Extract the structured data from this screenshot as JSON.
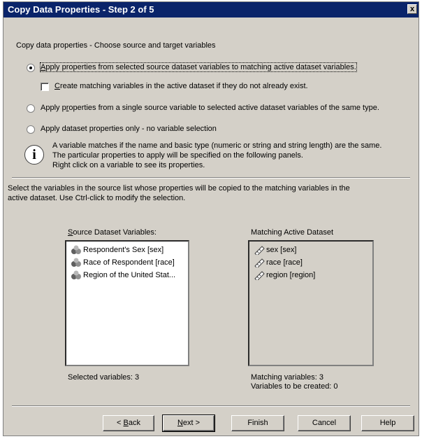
{
  "window": {
    "title": "Copy Data Properties - Step 2 of 5",
    "close_glyph": "x"
  },
  "heading": "Copy data properties - Choose source and target variables",
  "options": {
    "opt1": {
      "pre": "",
      "key": "A",
      "post": "pply properties from selected source dataset variables to matching active dataset variables.",
      "selected": true
    },
    "create_match": {
      "pre": "",
      "key": "C",
      "post": "reate matching variables in the active dataset if they do not already  exist.",
      "checked": false
    },
    "opt2": {
      "pre": "Apply p",
      "key": "r",
      "post": "operties from a single source variable to selected active dataset variables of the same type.",
      "selected": false
    },
    "opt3": {
      "label": "Apply dataset properties only -  no variable selection",
      "selected": false
    }
  },
  "info": {
    "icon_glyph": "i",
    "line1": "A variable matches if the name and basic type (numeric or string and string length) are the same.",
    "line2": "The particular properties to apply will be specified on the following panels.",
    "line3": "Right click on a variable to see its properties."
  },
  "instructions": {
    "line1": "Select the variables in the source list whose properties will be copied to the matching variables in the",
    "line2": "active dataset. Use Ctrl-click to modify the selection."
  },
  "source": {
    "label_key": "S",
    "label_rest": "ource Dataset Variables:",
    "items": [
      {
        "label": "Respondent's Sex [sex]",
        "icon": "nominal-variable-icon"
      },
      {
        "label": "Race of Respondent [race]",
        "icon": "nominal-variable-icon"
      },
      {
        "label": "Region of the United Stat...",
        "icon": "nominal-variable-icon"
      }
    ],
    "status": "Selected variables: 3"
  },
  "target": {
    "label": "Matching Active Dataset",
    "items": [
      {
        "label": "sex [sex]",
        "icon": "scale-variable-icon"
      },
      {
        "label": "race [race]",
        "icon": "scale-variable-icon"
      },
      {
        "label": "region [region]",
        "icon": "scale-variable-icon"
      }
    ],
    "status1": "Matching variables: 3",
    "status2": "Variables to be created: 0"
  },
  "buttons": {
    "back_pre": "< ",
    "back_key": "B",
    "back_post": "ack",
    "next_key": "N",
    "next_post": "ext >",
    "finish": "Finish",
    "cancel": "Cancel",
    "help": "Help"
  },
  "colors": {
    "titlebar": "#0a246a",
    "dialog_bg": "#d4d0c8",
    "selection": "#0a246a"
  }
}
